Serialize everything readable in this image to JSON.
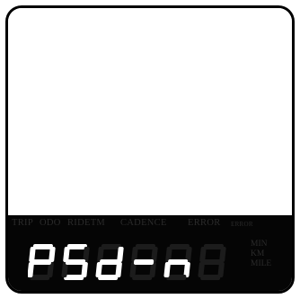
{
  "labels": {
    "trip": "TRIP",
    "odo": "ODO",
    "ridetm": "RIDETM",
    "cadence": "CADENCE",
    "error": "ERROR",
    "error2": "ERROR"
  },
  "display": {
    "text": "PSd-n8",
    "lit_chars": [
      "P",
      "S",
      "d",
      "-",
      "n"
    ],
    "dim_chars": [
      "8"
    ]
  },
  "units": {
    "min": "MIN",
    "km": "KM",
    "mile": "MILE"
  },
  "colors": {
    "lcd_bg": "#050505",
    "segment_on": "#ffffff",
    "segment_off": "#1c1c1c",
    "label_dim": "#2b2b2b"
  }
}
